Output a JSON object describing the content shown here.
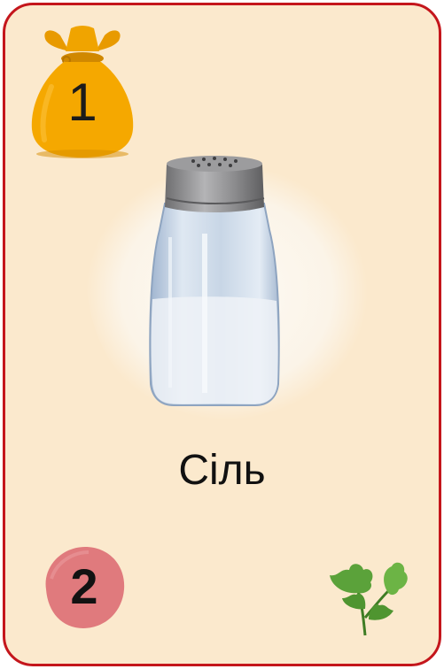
{
  "card": {
    "name": "Сіль",
    "cost": "1",
    "points": "2",
    "illustration_icon": "salt-shaker-icon",
    "category_icon": "parsley-icon",
    "cost_icon": "money-bag-icon"
  },
  "colors": {
    "border": "#c4161c",
    "background": "#fbe9cd",
    "coin_bag": "#f5a800",
    "points_badge": "#e07a7d",
    "parsley": "#5ba23a"
  }
}
